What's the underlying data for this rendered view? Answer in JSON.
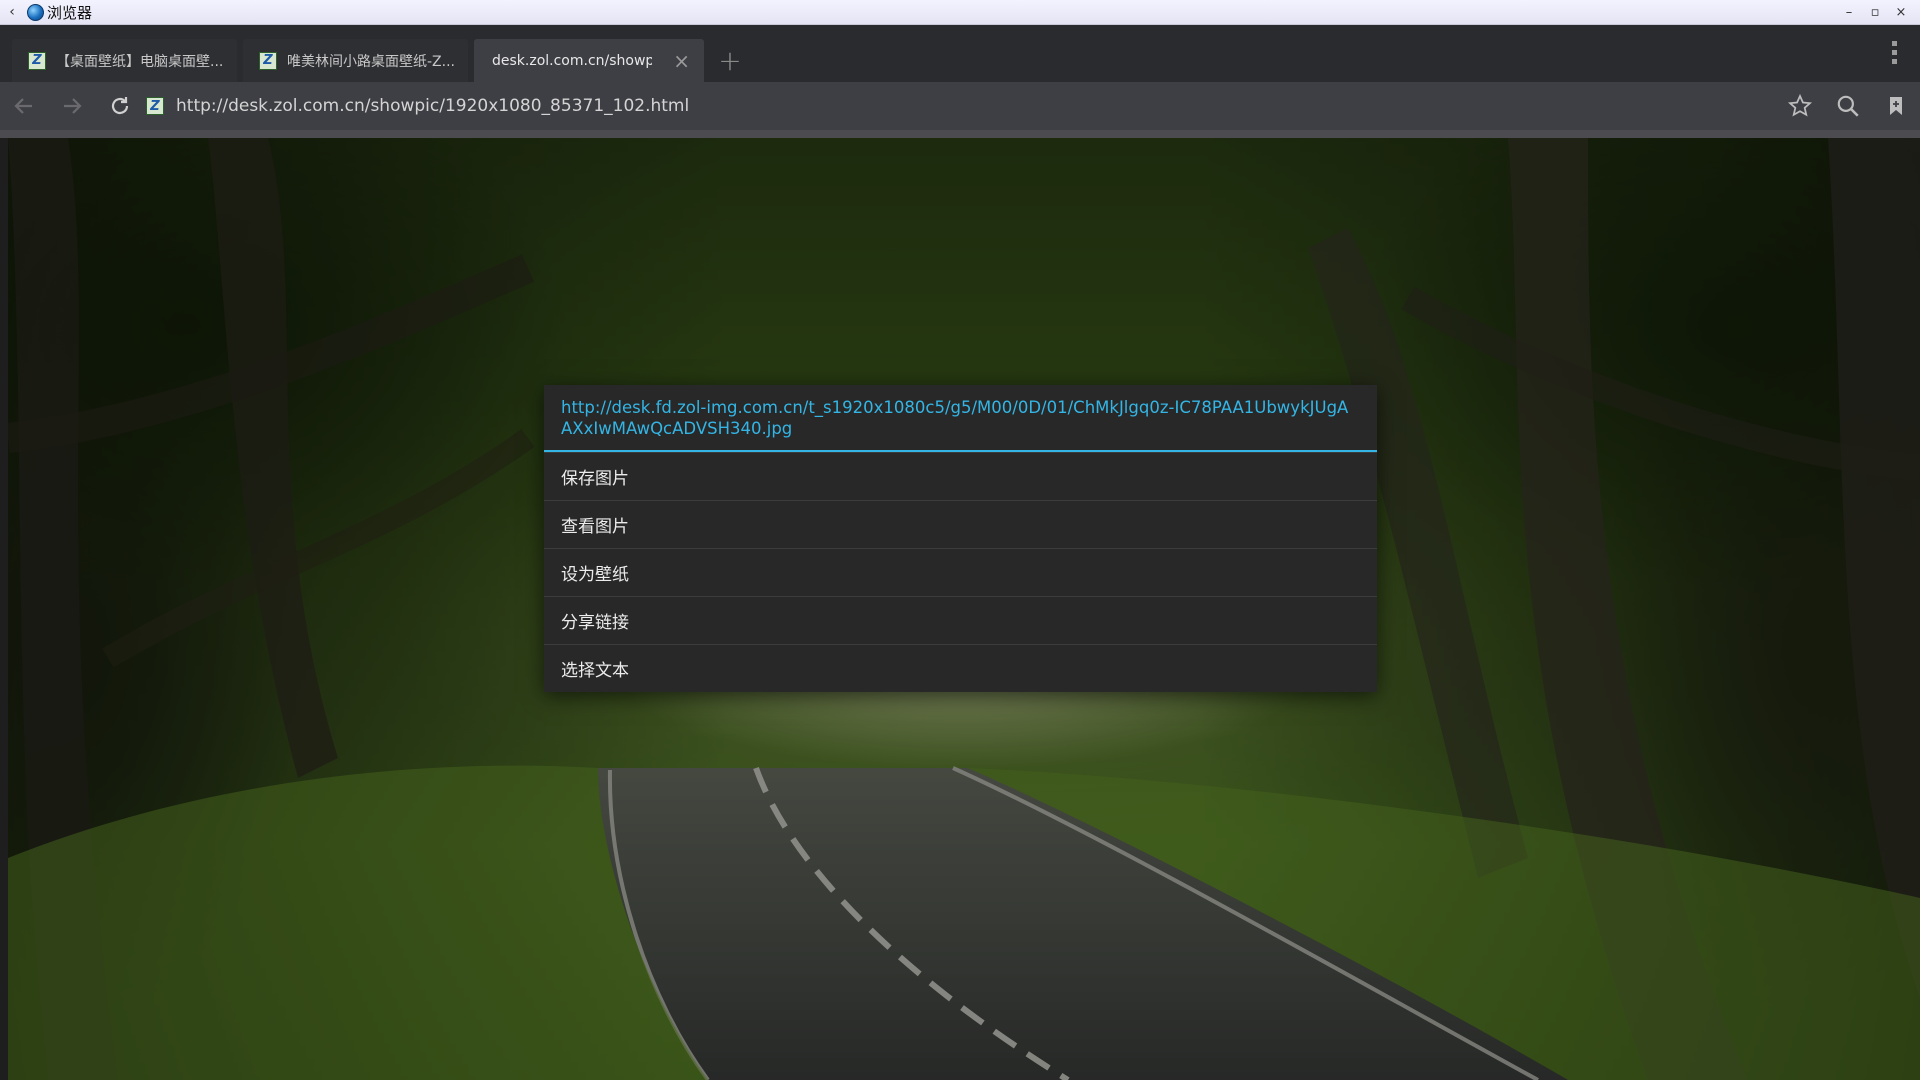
{
  "os_window": {
    "title": "浏览器",
    "back_glyph": "‹",
    "minimize_glyph": "–",
    "maximize_glyph": "▫",
    "close_glyph": "×"
  },
  "tabs": [
    {
      "title": "【桌面壁纸】电脑桌面壁...",
      "favicon": "zol-favicon",
      "active": false
    },
    {
      "title": "唯美林间小路桌面壁纸-Z...",
      "favicon": "zol-favicon",
      "active": false
    },
    {
      "title": "desk.zol.com.cn/showpi...",
      "favicon": "none",
      "active": true
    }
  ],
  "favicon_glyph": "Z",
  "new_tab_glyph": "+",
  "tab_close_glyph": "×",
  "address_bar": {
    "url": "http://desk.zol.com.cn/showpic/1920x1080_85371_102.html"
  },
  "context_menu": {
    "link_url": "http://desk.fd.zol-img.com.cn/t_s1920x1080c5/g5/M00/0D/01/ChMkJlgq0z-IC78PAA1UbwykJUgAAXxIwMAwQcADVSH340.jpg",
    "items": [
      "保存图片",
      "查看图片",
      "设为壁纸",
      "分享链接",
      "选择文本"
    ]
  },
  "colors": {
    "accent": "#33b5e5",
    "dialog_bg": "#282828",
    "toolbar_bg": "#3e3f44",
    "tabstrip_bg": "#2a2b2e"
  }
}
